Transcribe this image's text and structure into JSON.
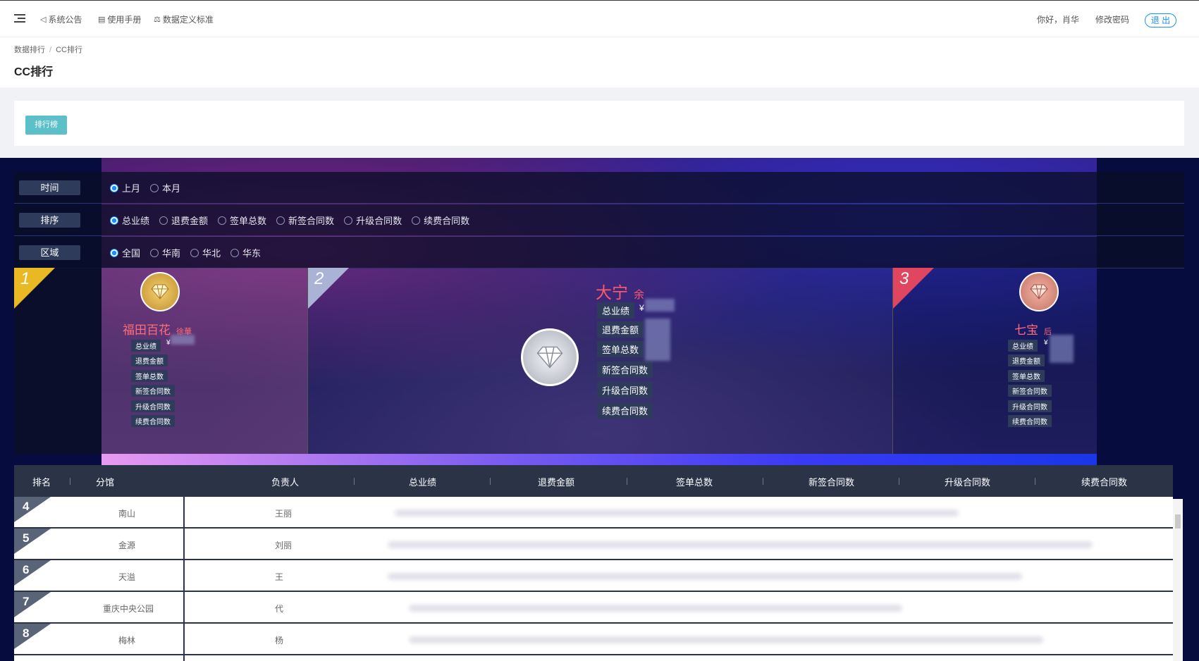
{
  "topbar": {
    "announce": "系统公告",
    "manual": "使用手册",
    "standard": "数据定义标准",
    "greeting": "你好，肖华",
    "change_pwd": "修改密码",
    "logout": "退 出"
  },
  "breadcrumb": {
    "parent": "数据排行",
    "sep": "/",
    "current": "CC排行"
  },
  "page_title": "CC排行",
  "rank_tab": "排行榜",
  "filters": [
    {
      "label": "时间",
      "options": [
        {
          "text": "上月",
          "checked": true
        },
        {
          "text": "本月",
          "checked": false
        }
      ]
    },
    {
      "label": "排序",
      "options": [
        {
          "text": "总业绩",
          "checked": true
        },
        {
          "text": "退费金额",
          "checked": false
        },
        {
          "text": "签单总数",
          "checked": false
        },
        {
          "text": "新签合同数",
          "checked": false
        },
        {
          "text": "升级合同数",
          "checked": false
        },
        {
          "text": "续费合同数",
          "checked": false
        }
      ]
    },
    {
      "label": "区域",
      "options": [
        {
          "text": "全国",
          "checked": true
        },
        {
          "text": "华南",
          "checked": false
        },
        {
          "text": "华北",
          "checked": false
        },
        {
          "text": "华东",
          "checked": false
        }
      ]
    }
  ],
  "podium": {
    "first": {
      "rank": "1",
      "name": "福田百花",
      "person": "徐華",
      "colors": {
        "ribbon": "#e8b923",
        "medal": "#d4a23c"
      }
    },
    "second": {
      "rank": "2",
      "name": "大宁",
      "person": "余",
      "colors": {
        "ribbon": "#aab3d6",
        "medal": "#c8ccd6"
      }
    },
    "third": {
      "rank": "3",
      "name": "七宝",
      "person": "后",
      "colors": {
        "ribbon": "#e04660",
        "medal": "#d88a7a"
      }
    },
    "stat_labels": [
      "总业绩",
      "退费金额",
      "签单总数",
      "新签合同数",
      "升级合同数",
      "续费合同数"
    ],
    "currency": "¥"
  },
  "table": {
    "headers": [
      "排名",
      "分馆",
      "负责人",
      "总业绩",
      "退费金额",
      "签单总数",
      "新签合同数",
      "升级合同数",
      "续费合同数"
    ],
    "rows": [
      {
        "rank": "4",
        "branch": "南山",
        "owner": "王丽"
      },
      {
        "rank": "5",
        "branch": "金源",
        "owner": "刘丽"
      },
      {
        "rank": "6",
        "branch": "天溢",
        "owner": "王"
      },
      {
        "rank": "7",
        "branch": "重庆中央公园",
        "owner": "代"
      },
      {
        "rank": "8",
        "branch": "梅林",
        "owner": "杨"
      }
    ]
  }
}
